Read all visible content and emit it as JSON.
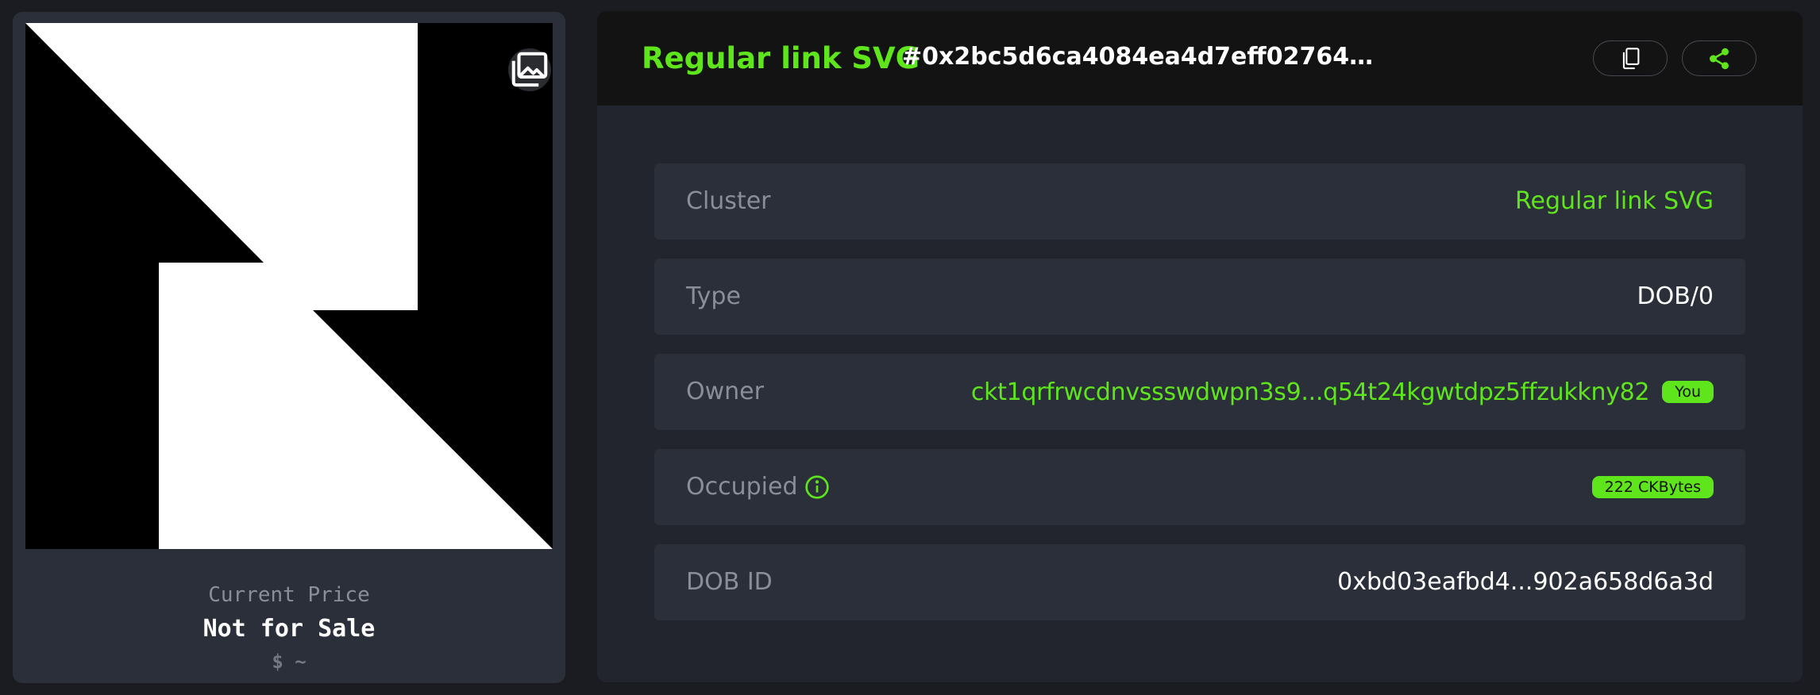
{
  "artwork": {
    "gallery_icon": "gallery-icon"
  },
  "price": {
    "label": "Current Price",
    "value": "Not for Sale",
    "usd": "$ ~"
  },
  "header": {
    "title": "Regular link SVG",
    "hash": "#0x2bc5d6ca4084ea4d7eff02764d84df4be116cfbbb...",
    "copy_icon": "copy-icon",
    "share_icon": "share-icon"
  },
  "details": {
    "cluster": {
      "label": "Cluster",
      "value": "Regular link SVG"
    },
    "type": {
      "label": "Type",
      "value": "DOB/0"
    },
    "owner": {
      "label": "Owner",
      "value": "ckt1qrfrwcdnvssswdwpn3s9...q54t24kgwtdpz5ffzukkny82",
      "badge": "You"
    },
    "occupied": {
      "label": "Occupied",
      "value": "222 CKBytes",
      "info_icon": "info-icon"
    },
    "dob_id": {
      "label": "DOB ID",
      "value": "0xbd03eafbd4...902a658d6a3d"
    }
  },
  "colors": {
    "accent": "#5fe51c",
    "background": "#1a1c21",
    "card": "#2b2f3a",
    "header": "#131313",
    "panel": "#22252d"
  }
}
